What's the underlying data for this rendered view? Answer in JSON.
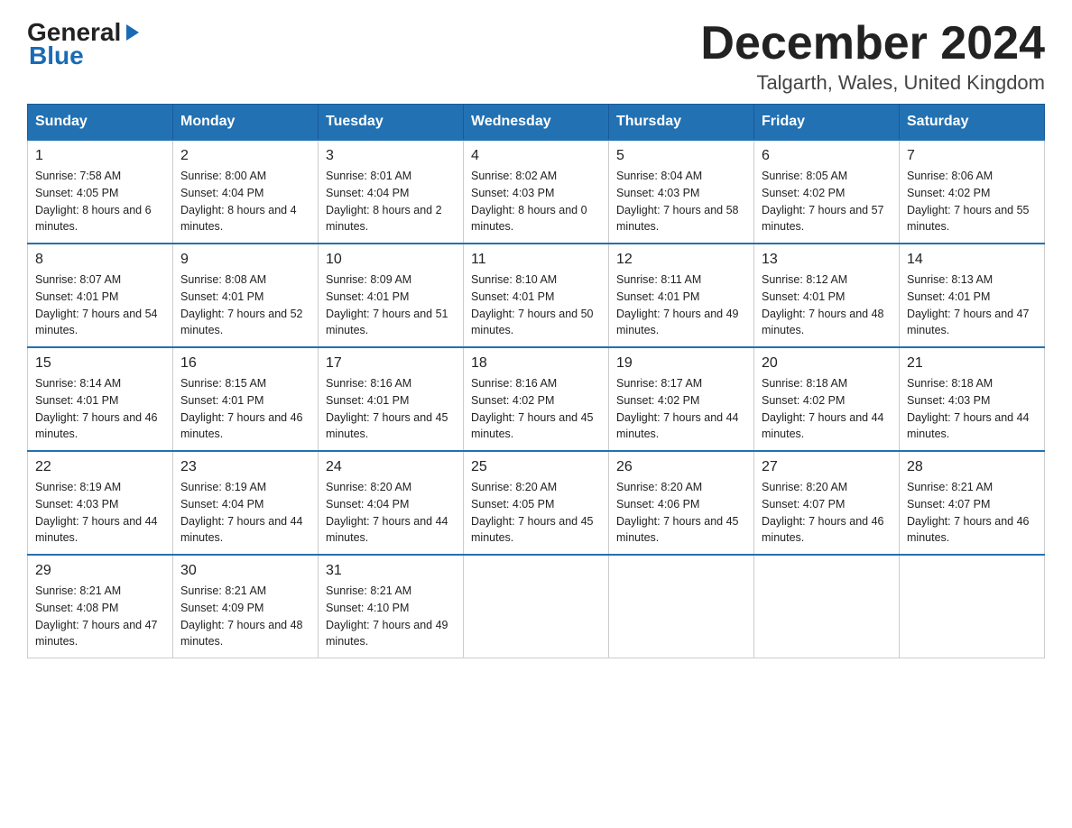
{
  "logo": {
    "text_general": "General",
    "text_blue": "Blue",
    "arrow": "▶"
  },
  "header": {
    "month_year": "December 2024",
    "location": "Talgarth, Wales, United Kingdom"
  },
  "weekdays": [
    "Sunday",
    "Monday",
    "Tuesday",
    "Wednesday",
    "Thursday",
    "Friday",
    "Saturday"
  ],
  "weeks": [
    [
      {
        "day": "1",
        "sunrise": "7:58 AM",
        "sunset": "4:05 PM",
        "daylight": "8 hours and 6 minutes."
      },
      {
        "day": "2",
        "sunrise": "8:00 AM",
        "sunset": "4:04 PM",
        "daylight": "8 hours and 4 minutes."
      },
      {
        "day": "3",
        "sunrise": "8:01 AM",
        "sunset": "4:04 PM",
        "daylight": "8 hours and 2 minutes."
      },
      {
        "day": "4",
        "sunrise": "8:02 AM",
        "sunset": "4:03 PM",
        "daylight": "8 hours and 0 minutes."
      },
      {
        "day": "5",
        "sunrise": "8:04 AM",
        "sunset": "4:03 PM",
        "daylight": "7 hours and 58 minutes."
      },
      {
        "day": "6",
        "sunrise": "8:05 AM",
        "sunset": "4:02 PM",
        "daylight": "7 hours and 57 minutes."
      },
      {
        "day": "7",
        "sunrise": "8:06 AM",
        "sunset": "4:02 PM",
        "daylight": "7 hours and 55 minutes."
      }
    ],
    [
      {
        "day": "8",
        "sunrise": "8:07 AM",
        "sunset": "4:01 PM",
        "daylight": "7 hours and 54 minutes."
      },
      {
        "day": "9",
        "sunrise": "8:08 AM",
        "sunset": "4:01 PM",
        "daylight": "7 hours and 52 minutes."
      },
      {
        "day": "10",
        "sunrise": "8:09 AM",
        "sunset": "4:01 PM",
        "daylight": "7 hours and 51 minutes."
      },
      {
        "day": "11",
        "sunrise": "8:10 AM",
        "sunset": "4:01 PM",
        "daylight": "7 hours and 50 minutes."
      },
      {
        "day": "12",
        "sunrise": "8:11 AM",
        "sunset": "4:01 PM",
        "daylight": "7 hours and 49 minutes."
      },
      {
        "day": "13",
        "sunrise": "8:12 AM",
        "sunset": "4:01 PM",
        "daylight": "7 hours and 48 minutes."
      },
      {
        "day": "14",
        "sunrise": "8:13 AM",
        "sunset": "4:01 PM",
        "daylight": "7 hours and 47 minutes."
      }
    ],
    [
      {
        "day": "15",
        "sunrise": "8:14 AM",
        "sunset": "4:01 PM",
        "daylight": "7 hours and 46 minutes."
      },
      {
        "day": "16",
        "sunrise": "8:15 AM",
        "sunset": "4:01 PM",
        "daylight": "7 hours and 46 minutes."
      },
      {
        "day": "17",
        "sunrise": "8:16 AM",
        "sunset": "4:01 PM",
        "daylight": "7 hours and 45 minutes."
      },
      {
        "day": "18",
        "sunrise": "8:16 AM",
        "sunset": "4:02 PM",
        "daylight": "7 hours and 45 minutes."
      },
      {
        "day": "19",
        "sunrise": "8:17 AM",
        "sunset": "4:02 PM",
        "daylight": "7 hours and 44 minutes."
      },
      {
        "day": "20",
        "sunrise": "8:18 AM",
        "sunset": "4:02 PM",
        "daylight": "7 hours and 44 minutes."
      },
      {
        "day": "21",
        "sunrise": "8:18 AM",
        "sunset": "4:03 PM",
        "daylight": "7 hours and 44 minutes."
      }
    ],
    [
      {
        "day": "22",
        "sunrise": "8:19 AM",
        "sunset": "4:03 PM",
        "daylight": "7 hours and 44 minutes."
      },
      {
        "day": "23",
        "sunrise": "8:19 AM",
        "sunset": "4:04 PM",
        "daylight": "7 hours and 44 minutes."
      },
      {
        "day": "24",
        "sunrise": "8:20 AM",
        "sunset": "4:04 PM",
        "daylight": "7 hours and 44 minutes."
      },
      {
        "day": "25",
        "sunrise": "8:20 AM",
        "sunset": "4:05 PM",
        "daylight": "7 hours and 45 minutes."
      },
      {
        "day": "26",
        "sunrise": "8:20 AM",
        "sunset": "4:06 PM",
        "daylight": "7 hours and 45 minutes."
      },
      {
        "day": "27",
        "sunrise": "8:20 AM",
        "sunset": "4:07 PM",
        "daylight": "7 hours and 46 minutes."
      },
      {
        "day": "28",
        "sunrise": "8:21 AM",
        "sunset": "4:07 PM",
        "daylight": "7 hours and 46 minutes."
      }
    ],
    [
      {
        "day": "29",
        "sunrise": "8:21 AM",
        "sunset": "4:08 PM",
        "daylight": "7 hours and 47 minutes."
      },
      {
        "day": "30",
        "sunrise": "8:21 AM",
        "sunset": "4:09 PM",
        "daylight": "7 hours and 48 minutes."
      },
      {
        "day": "31",
        "sunrise": "8:21 AM",
        "sunset": "4:10 PM",
        "daylight": "7 hours and 49 minutes."
      },
      null,
      null,
      null,
      null
    ]
  ],
  "labels": {
    "sunrise": "Sunrise:",
    "sunset": "Sunset:",
    "daylight": "Daylight:"
  }
}
